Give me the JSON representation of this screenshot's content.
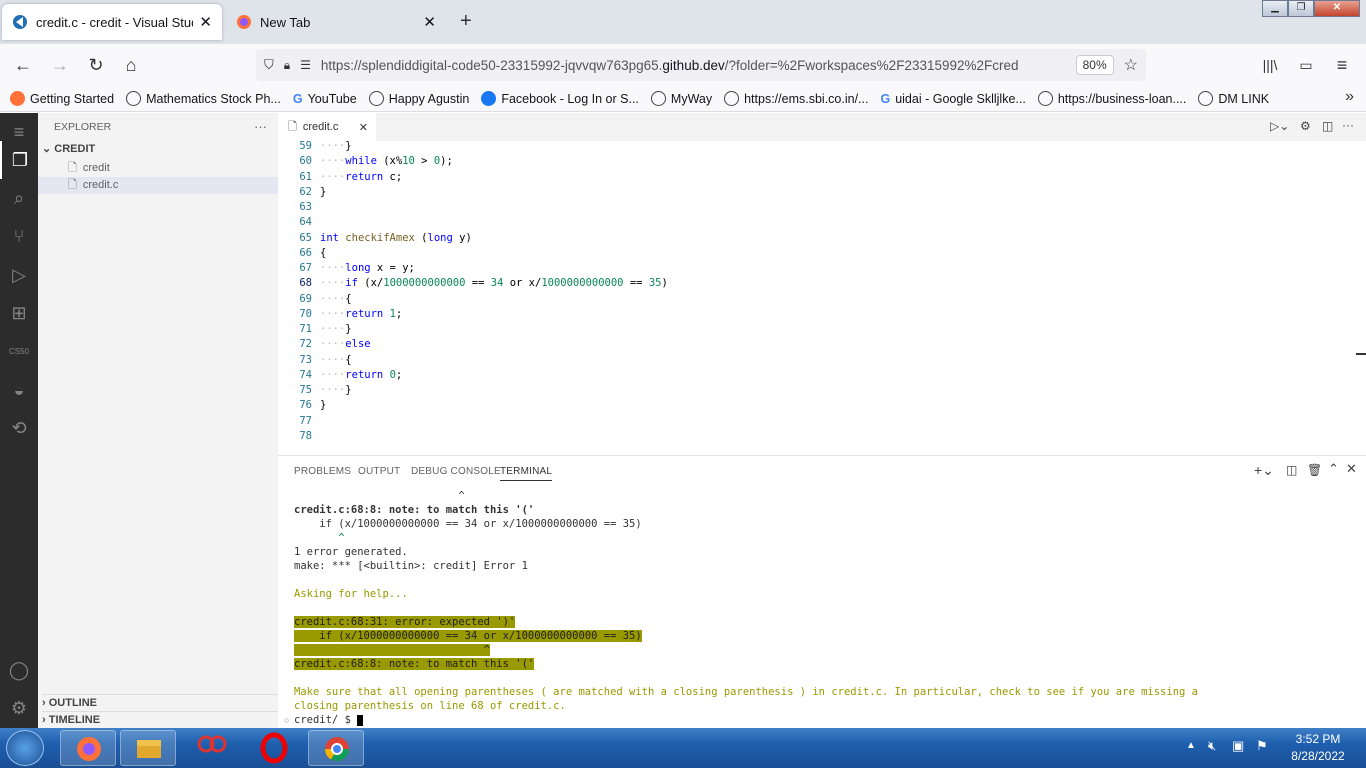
{
  "browser": {
    "tabs": [
      {
        "title": "credit.c - credit - Visual Studio Code",
        "close": "✕"
      },
      {
        "title": "New Tab",
        "close": "✕"
      }
    ],
    "new_tab": "+",
    "url_prefix": "https://splendiddigital-code50-23315992-jqvvqw763pg65.",
    "url_domain": "github.dev",
    "url_suffix": "/?folder=%2Fworkspaces%2F23315992%2Fcred",
    "zoom": "80%",
    "bookmarks": [
      "Getting Started",
      "Mathematics Stock Ph...",
      "YouTube",
      "Happy Agustin",
      "Facebook - Log In or S...",
      "MyWay",
      "https://ems.sbi.co.in/...",
      "uidai - Google Sklljlke...",
      "https://business-loan....",
      "DM LINK"
    ]
  },
  "explorer": {
    "title": "EXPLORER",
    "more": "···",
    "folder": "CREDIT",
    "files": [
      "credit",
      "credit.c"
    ],
    "outline": "OUTLINE",
    "timeline": "TIMELINE",
    "cs50_label": "CS50"
  },
  "editor": {
    "tab": "credit.c",
    "lines": [
      {
        "n": "59",
        "t": "····}"
      },
      {
        "n": "60",
        "t": "····while (x%10 > 0);"
      },
      {
        "n": "61",
        "t": "····return c;"
      },
      {
        "n": "62",
        "t": "}"
      },
      {
        "n": "63",
        "t": ""
      },
      {
        "n": "64",
        "t": ""
      },
      {
        "n": "65",
        "t": "int checkifAmex (long y)"
      },
      {
        "n": "66",
        "t": "{"
      },
      {
        "n": "67",
        "t": "····long x = y;"
      },
      {
        "n": "68",
        "t": "····if (x/1000000000000 == 34 or x/1000000000000 == 35)"
      },
      {
        "n": "69",
        "t": "····{"
      },
      {
        "n": "70",
        "t": "····return 1;"
      },
      {
        "n": "71",
        "t": "····}"
      },
      {
        "n": "72",
        "t": "····else"
      },
      {
        "n": "73",
        "t": "····{"
      },
      {
        "n": "74",
        "t": "····return 0;"
      },
      {
        "n": "75",
        "t": "····}"
      },
      {
        "n": "76",
        "t": "}"
      },
      {
        "n": "77",
        "t": ""
      },
      {
        "n": "78",
        "t": ""
      }
    ]
  },
  "panel": {
    "tabs": [
      "PROBLEMS",
      "OUTPUT",
      "DEBUG CONSOLE",
      "TERMINAL"
    ],
    "active_tab": "TERMINAL",
    "terminal": {
      "l1": "                          ^",
      "l2": "credit.c:68:8: note: to match this '('",
      "l3": "    if (x/1000000000000 == 34 or x/1000000000000 == 35)",
      "l4": "       ^",
      "l5": "1 error generated.",
      "l6": "make: *** [<builtin>: credit] Error 1",
      "l7": "Asking for help...",
      "h1": "credit.c:68:31: error: expected ')'",
      "h2": "    if (x/1000000000000 == 34 or x/1000000000000 == 35)",
      "h3": "                              ^",
      "h4": "credit.c:68:8: note: to match this '('",
      "m1": "Make sure that all opening parentheses ( are matched with a closing parenthesis ) in credit.c. In particular, check to see if you are missing a",
      "m2": "closing parenthesis on line 68 of credit.c.",
      "prompt": "credit/ $ "
    }
  },
  "taskbar": {
    "time": "3:52 PM",
    "date": "8/28/2022"
  }
}
